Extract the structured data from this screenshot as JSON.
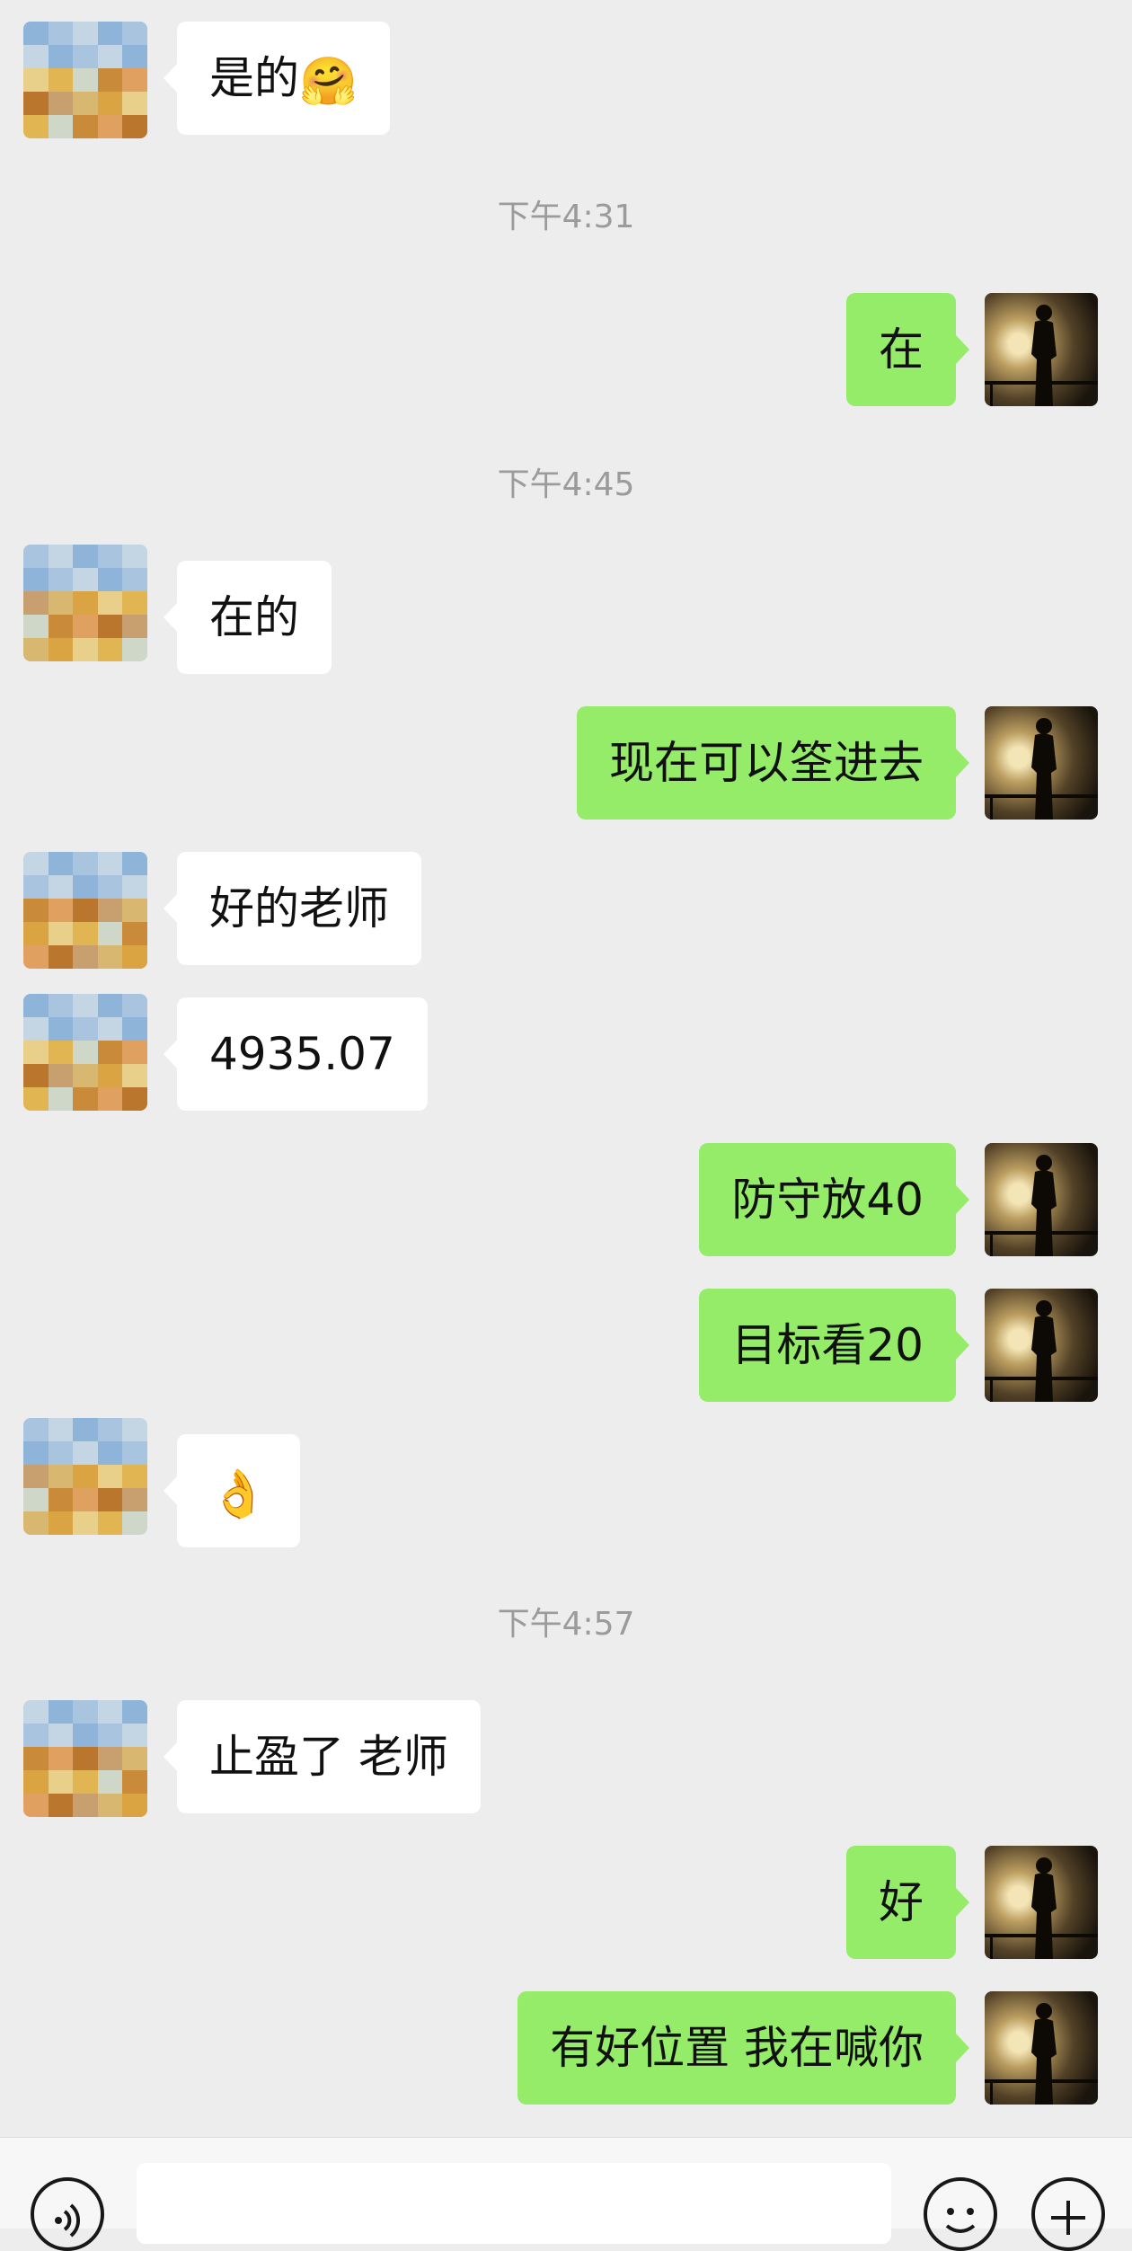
{
  "colors": {
    "background": "#ededed",
    "incoming_bubble": "#ffffff",
    "outgoing_bubble": "#95ec69",
    "timestamp": "#9b9b9b"
  },
  "messages": [
    {
      "kind": "in",
      "text": "是的",
      "emoji": "🤗"
    },
    {
      "kind": "time",
      "text": "下午4:31"
    },
    {
      "kind": "out",
      "text": "在"
    },
    {
      "kind": "time",
      "text": "下午4:45"
    },
    {
      "kind": "in",
      "text": "在的"
    },
    {
      "kind": "out",
      "text": "现在可以筌进去"
    },
    {
      "kind": "in",
      "text": "好的老师"
    },
    {
      "kind": "in",
      "text": "4935.07"
    },
    {
      "kind": "out",
      "text": "防守放40"
    },
    {
      "kind": "out",
      "text": "目标看20"
    },
    {
      "kind": "in",
      "text": "",
      "emoji": "👌"
    },
    {
      "kind": "time",
      "text": "下午4:57"
    },
    {
      "kind": "in",
      "text": "止盈了 老师"
    },
    {
      "kind": "out",
      "text": "好"
    },
    {
      "kind": "out",
      "text": "有好位置 我在喊你"
    }
  ],
  "input_bar": {
    "voice_icon": "voice-icon",
    "emoji_icon": "emoji-icon",
    "add_icon": "plus-icon",
    "input_value": ""
  }
}
